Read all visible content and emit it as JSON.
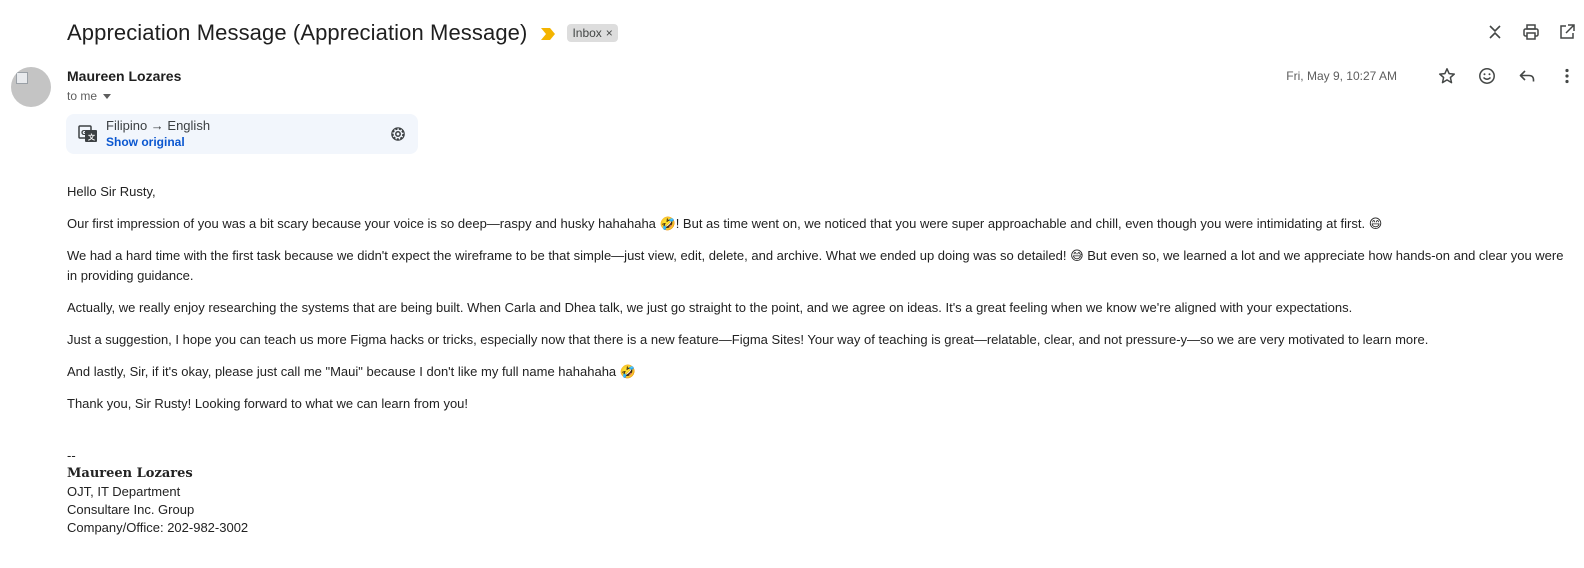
{
  "email": {
    "subject": "Appreciation Message (Appreciation Message)",
    "label": "Inbox",
    "label_close": "×",
    "sender_name": "Maureen Lozares",
    "recipient": "to me",
    "date": "Fri, May 9, 10:27 AM"
  },
  "colors": {
    "importance_marker": "#f4b400",
    "link": "#0b57d0",
    "translate_bg": "#f2f6fc"
  },
  "icons": {
    "top": [
      "collapse-all-icon",
      "print-icon",
      "open-in-new-window-icon"
    ],
    "message": [
      "star-icon",
      "emoji-reaction-icon",
      "reply-icon",
      "more-options-icon"
    ]
  },
  "translation": {
    "languages": "Filipino → English",
    "show_original": "Show original"
  },
  "body": {
    "greeting": "Hello Sir Rusty,",
    "paragraphs": [
      "Our first impression of you was a bit scary because your voice is so deep—raspy and husky hahahaha 🤣! But as time went on, we noticed that you were super approachable and chill, even though you were intimidating at first. 😄",
      "We had a hard time with the first task because we didn't expect the wireframe to be that simple—just view, edit, delete, and archive. What we ended up doing was so detailed! 😅 But even so, we learned a lot and we appreciate how hands-on and clear you were in providing guidance.",
      "Actually, we really enjoy researching the systems that are being built. When Carla and Dhea talk, we just go straight to the point, and we agree on ideas. It's a great feeling when we know we're aligned with your expectations.",
      "Just a suggestion, I hope you can teach us more Figma hacks or tricks, especially now that there is a new feature—Figma Sites! Your way of teaching is great—relatable, clear, and not pressure-y—so we are very motivated to learn more.",
      "And lastly, Sir, if it's okay, please just call me \"Maui\" because I don't like my full name hahahaha 🤣",
      "Thank you, Sir Rusty! Looking forward to what we can learn from you!"
    ]
  },
  "signature": {
    "separator": "--",
    "name": "Maureen Lozares",
    "role": "OJT, IT Department",
    "company": "Consultare Inc. Group",
    "phone": "Company/Office: 202-982-3002"
  }
}
